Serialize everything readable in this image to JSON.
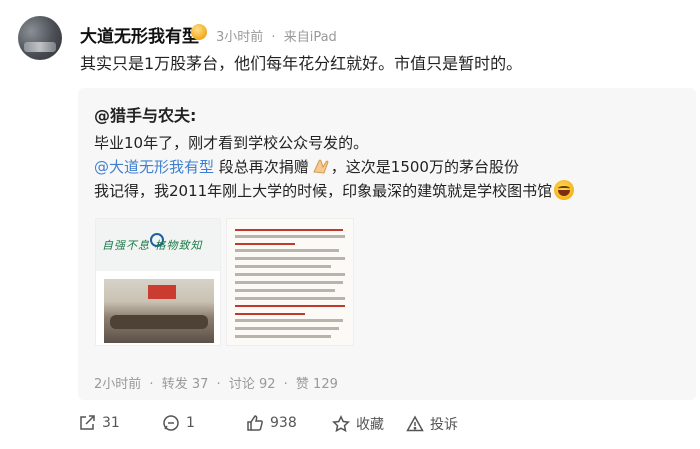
{
  "post": {
    "username": "大道无形我有型",
    "time": "3小时前",
    "source": "来自iPad",
    "text": "其实只是1万股茅台，他们每年花分红就好。市值只是暂时的。"
  },
  "quoted": {
    "author": "@猎手与农夫:",
    "line1": "毕业10年了，刚才看到学校公众号发的。",
    "line2_mention": "@大道无形我有型",
    "line2_mid": " 段总再次捐赠",
    "line2_end": "，这次是1500万的茅台股份",
    "line3": "我记得，我2011年刚上大学的时候，印象最深的建筑就是学校图书馆",
    "image1_banner": "自强不息 格物致知",
    "time": "2小时前",
    "sep": "·",
    "repost": "转发 37",
    "comment": "讨论 92",
    "like": "赞 129"
  },
  "actions": {
    "share_count": "31",
    "comment_count": "1",
    "like_count": "938",
    "favorite_label": "收藏",
    "report_label": "投诉"
  },
  "colors": {
    "mention": "#3f7fd1",
    "meta_gray": "#999999",
    "quote_bg": "#f7f7f7"
  },
  "icons": [
    "vip-badge-icon",
    "clap-emoji-icon",
    "laugh-emoji-icon",
    "share-icon",
    "comment-icon",
    "like-icon",
    "star-icon",
    "report-icon"
  ]
}
